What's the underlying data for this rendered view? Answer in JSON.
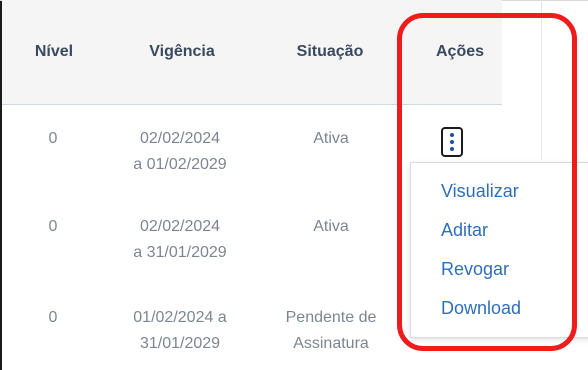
{
  "table": {
    "headers": {
      "nivel": "Nível",
      "vigencia": "Vigência",
      "situacao": "Situação",
      "acoes": "Ações"
    },
    "rows": [
      {
        "nivel": "0",
        "vigencia_line1": "02/02/2024",
        "vigencia_line2": "a 01/02/2029",
        "situacao_line1": "Ativa",
        "situacao_line2": ""
      },
      {
        "nivel": "0",
        "vigencia_line1": "02/02/2024",
        "vigencia_line2": "a 31/01/2029",
        "situacao_line1": "Ativa",
        "situacao_line2": ""
      },
      {
        "nivel": "0",
        "vigencia_line1": "01/02/2024 a",
        "vigencia_line2": "31/01/2029",
        "situacao_line1": "Pendente de",
        "situacao_line2": "Assinatura"
      }
    ]
  },
  "actions_menu": {
    "trigger_icon": "kebab-vertical-icon",
    "items": [
      "Visualizar",
      "Aditar",
      "Revogar",
      "Download"
    ]
  },
  "colors": {
    "header_text": "#3a4a5e",
    "cell_text": "#7c8692",
    "menu_link": "#2f6ebd",
    "highlight": "#ee1c1c",
    "header_bg": "#f5f5f5"
  }
}
